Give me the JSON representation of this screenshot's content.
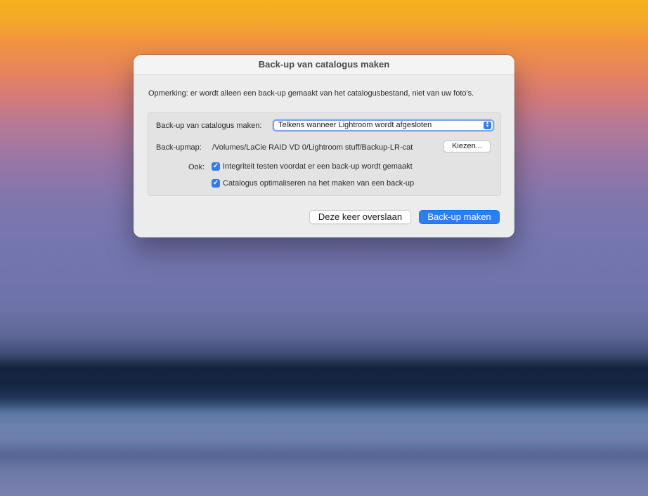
{
  "dialog": {
    "title": "Back-up van catalogus maken",
    "note": "Opmerking: er wordt alleen een back-up gemaakt van het catalogusbestand, niet van uw foto's.",
    "frequency": {
      "label": "Back-up van catalogus maken:",
      "selected": "Telkens wanneer Lightroom wordt afgesloten"
    },
    "folder": {
      "label": "Back-upmap:",
      "path": "/Volumes/LaCie RAID VD 0/Lightroom stuff/Backup-LR-cat",
      "choose_label": "Kiezen..."
    },
    "also": {
      "label": "Ook:",
      "options": [
        {
          "label": "Integriteit testen voordat er een back-up wordt gemaakt",
          "checked": true
        },
        {
          "label": "Catalogus optimaliseren na het maken van een back-up",
          "checked": true
        }
      ]
    },
    "buttons": {
      "skip_label": "Deze keer overslaan",
      "backup_label": "Back-up maken"
    }
  },
  "colors": {
    "accent": "#2a7ff6",
    "dialog_background": "#ececec"
  }
}
